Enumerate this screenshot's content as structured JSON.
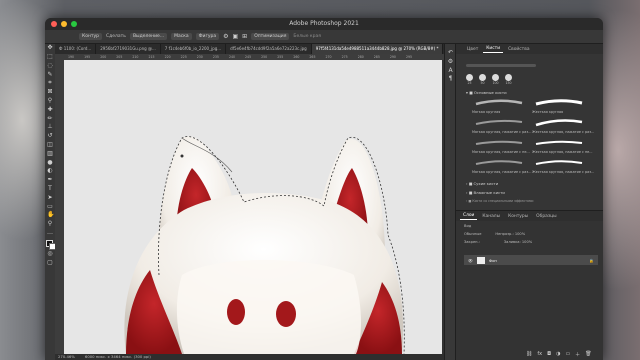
{
  "window": {
    "title": "Adobe Photoshop 2021"
  },
  "options_bar": {
    "items": [
      "Контур",
      "Сделать",
      "Выделение...",
      "Маска",
      "Фигура",
      "Оптимизация",
      "Белые края"
    ]
  },
  "tabs": [
    {
      "label": "Ф 1100: (Cord...",
      "active": false
    },
    {
      "label": "2956bf2719031Gu.png @...",
      "active": false
    },
    {
      "label": "7 f1c4eb6f0b_io_2200_jpg...",
      "active": false
    },
    {
      "label": "df5e6e4fb74cdd9f2a5a6e72a223c.jpg",
      "active": false
    },
    {
      "label": "97f5f4131da54e4988511a3444b828.jpg @ 270% (RGB/8#) *",
      "active": true
    }
  ],
  "ruler_ticks": [
    "190",
    "195",
    "200",
    "205",
    "210",
    "215",
    "220",
    "225",
    "230",
    "235",
    "240",
    "245",
    "250",
    "255",
    "260",
    "265",
    "270",
    "275",
    "280",
    "285",
    "290",
    "295"
  ],
  "status_bar": {
    "zoom": "270.46%",
    "info": "6000 пикс. x 3464 пикс. (300 ppi)"
  },
  "right_panel": {
    "tabs": [
      {
        "label": "Цвет",
        "active": false
      },
      {
        "label": "Кисти",
        "active": true
      },
      {
        "label": "Свойства",
        "active": false
      }
    ],
    "size_values": [
      "25",
      "50",
      "100",
      "150"
    ],
    "brush_group_main": "Основные кисти",
    "brushes": [
      "Мягкая круглая",
      "Жесткая круглая",
      "Мягкая круглая, нажатие с раз...",
      "Жесткая круглая, нажатие с раз...",
      "Мягкая круглая, нажатие с не...",
      "Жесткая круглая, нажатие с не...",
      "Мягкая круглая, нажатие с раз...",
      "Жесткая круглая, нажатие с раз..."
    ],
    "brush_groups": [
      "Сухие кисти",
      "Влажные кисти",
      "Кисти со специальными эффектами"
    ]
  },
  "layers_panel": {
    "tabs": [
      {
        "label": "Слои",
        "active": true
      },
      {
        "label": "Каналы",
        "active": false
      },
      {
        "label": "Контуры",
        "active": false
      },
      {
        "label": "Образцы",
        "active": false
      }
    ],
    "filter": "Вид",
    "blend_mode": "Обычные",
    "opacity_label": "Непрозр.:",
    "opacity": "100%",
    "lock_label": "Закреп.:",
    "fill_label": "Заливка:",
    "fill": "100%",
    "layer_name": "Фон"
  },
  "colors": {
    "accent_red": "#b01a1f",
    "mask_white": "#f4f1ec",
    "canvas_bg": "#e6e6e6"
  }
}
